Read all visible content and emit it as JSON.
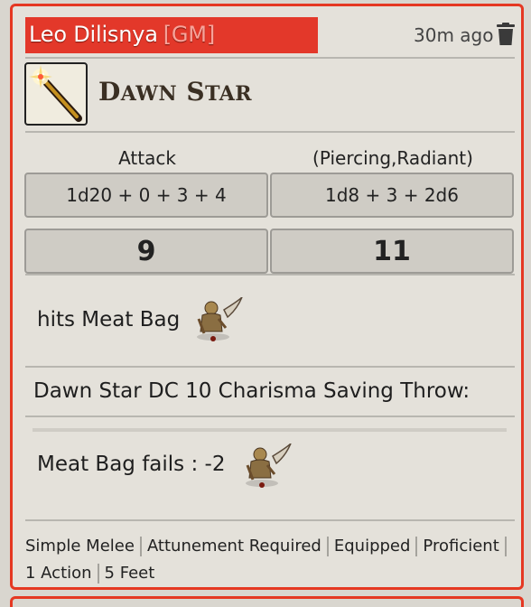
{
  "message": {
    "sender": "Leo Dilisnya",
    "role_tag": "[GM]",
    "timestamp": "30m ago",
    "delete_icon": "trash-icon"
  },
  "item": {
    "name_initial": "D",
    "name_rest_1": "AWN",
    "name_initial_2": "S",
    "name_rest_2": "TAR",
    "icon": "magic-wand-icon"
  },
  "attack": {
    "label": "Attack",
    "formula": "1d20 + 0 + 3 + 4",
    "total": "9"
  },
  "damage": {
    "label": "(Piercing,Radiant)",
    "formula": "1d8 + 3 + 2d6",
    "total": "11"
  },
  "hit_line": {
    "text": "hits Meat Bag",
    "token_icon": "goblin-token-icon"
  },
  "save": {
    "title": "Dawn Star DC 10 Charisma Saving Throw:",
    "result": "Meat Bag fails : -2",
    "token_icon": "goblin-token-icon"
  },
  "properties": [
    "Simple Melee",
    "Attunement Required",
    "Equipped",
    "Proficient",
    "1 Action",
    "5 Feet"
  ],
  "colors": {
    "accent": "#e53822",
    "background": "#e4e1da"
  }
}
